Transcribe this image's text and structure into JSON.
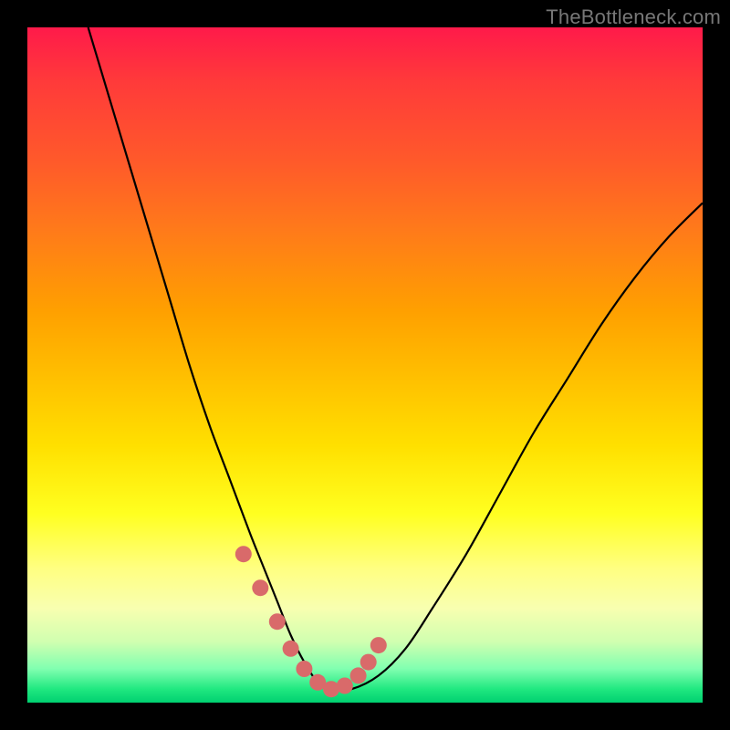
{
  "watermark": "TheBottleneck.com",
  "chart_data": {
    "type": "line",
    "title": "",
    "xlabel": "",
    "ylabel": "",
    "xlim": [
      0,
      100
    ],
    "ylim": [
      0,
      100
    ],
    "series": [
      {
        "name": "bottleneck-curve",
        "x": [
          9,
          12,
          15,
          18,
          21,
          24,
          27,
          30,
          33,
          35,
          37,
          39,
          41,
          43,
          45,
          48,
          52,
          56,
          60,
          65,
          70,
          75,
          80,
          85,
          90,
          95,
          100
        ],
        "y": [
          100,
          90,
          80,
          70,
          60,
          50,
          41,
          33,
          25,
          20,
          15,
          10,
          6,
          3,
          2,
          2,
          4,
          8,
          14,
          22,
          31,
          40,
          48,
          56,
          63,
          69,
          74
        ]
      }
    ],
    "markers": {
      "name": "optimal-region",
      "x": [
        32,
        34.5,
        37,
        39,
        41,
        43,
        45,
        47,
        49,
        50.5,
        52
      ],
      "y": [
        22,
        17,
        12,
        8,
        5,
        3,
        2,
        2.5,
        4,
        6,
        8.5
      ]
    }
  }
}
